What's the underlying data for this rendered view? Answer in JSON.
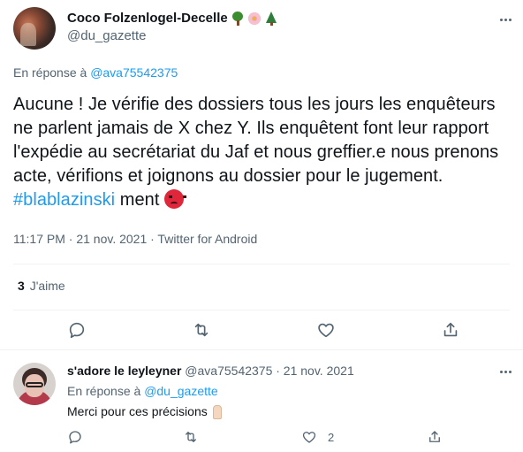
{
  "tweet": {
    "display_name": "Coco Folzenlogel-Decelle",
    "name_emojis": [
      "tree-icon",
      "flower-icon",
      "fir-tree-icon"
    ],
    "handle": "@du_gazette",
    "reply_prefix": "En réponse à",
    "reply_handle": "@ava75542375",
    "text_main": "Aucune ! Je vérifie des dossiers tous les jours les enquêteurs ne parlent jamais de X chez Y. Ils enquêtent font leur rapport  l'expédie au secrétariat du Jaf et nous greffier.e nous prenons acte, vérifions et joignons au dossier pour le jugement. ",
    "hashtag": "#blablazinski",
    "text_tail": " ment",
    "meta": "11:17 PM · 21 nov. 2021 · Twitter for Android",
    "likes_count": "3",
    "likes_label": "J'aime"
  },
  "reply": {
    "display_name": "s'adore le leyleyner",
    "handle_date": "@ava75542375 · 21 nov. 2021",
    "reply_prefix": "En réponse à",
    "reply_handle": "@du_gazette",
    "text": "Merci pour ces précisions",
    "like_count": "2"
  },
  "colors": {
    "text": "#0f1419",
    "secondary": "#536471",
    "link": "#1d9bf0",
    "divider": "#eff3f4"
  }
}
